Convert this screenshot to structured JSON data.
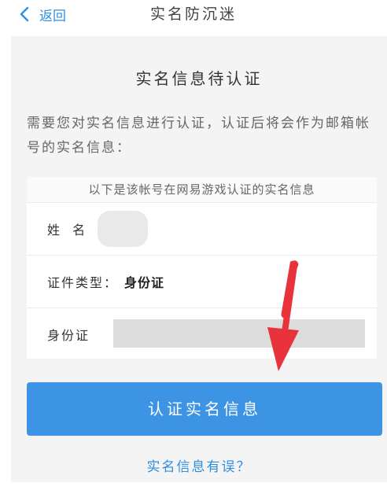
{
  "header": {
    "back_label": "返回",
    "title": "实名防沉迷"
  },
  "main": {
    "section_title": "实名信息待认证",
    "description": "需要您对实名信息进行认证，认证后将会作为邮箱帐号的实名信息："
  },
  "card": {
    "header": "以下是该帐号在网易游戏认证的实名信息",
    "rows": [
      {
        "label": "姓  名",
        "value": ""
      },
      {
        "label": "证件类型：",
        "value": "身份证"
      },
      {
        "label": "身份证",
        "value": ""
      }
    ]
  },
  "actions": {
    "verify_label": "认证实名信息",
    "error_link": "实名信息有误？"
  },
  "colors": {
    "accent": "#3d93e4",
    "link": "#2e8fe0",
    "arrow": "#e8323c",
    "background": "#f4f4f4"
  }
}
